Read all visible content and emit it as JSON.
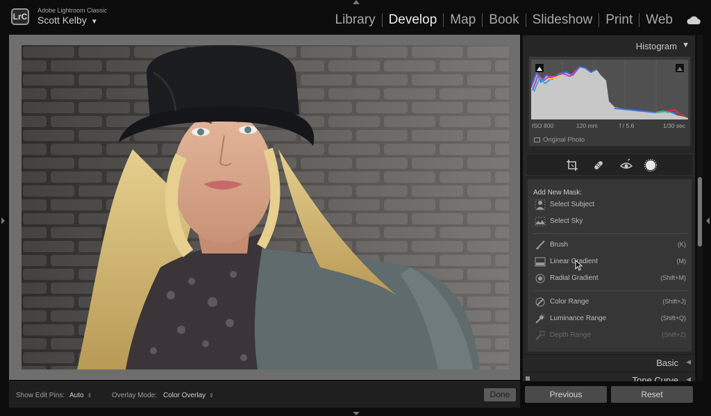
{
  "app": {
    "logo": "LrC",
    "name": "Adobe Lightroom Classic",
    "user": "Scott Kelby"
  },
  "modules": [
    "Library",
    "Develop",
    "Map",
    "Book",
    "Slideshow",
    "Print",
    "Web"
  ],
  "active_module": "Develop",
  "toolbar": {
    "show_edit_pins_label": "Show Edit Pins:",
    "show_edit_pins_value": "Auto",
    "overlay_mode_label": "Overlay Mode:",
    "overlay_mode_value": "Color Overlay",
    "done_label": "Done"
  },
  "histogram": {
    "title": "Histogram",
    "iso": "ISO 800",
    "focal_length": "120 mm",
    "aperture": "f / 5.6",
    "shutter": "1/30 sec",
    "original_photo": "Original Photo"
  },
  "tools": [
    "crop-icon",
    "healing-icon",
    "red-eye-icon",
    "masking-icon"
  ],
  "masking": {
    "heading": "Add New Mask:",
    "items": [
      {
        "label": "Select Subject",
        "shortcut": "",
        "icon": "person-icon"
      },
      {
        "label": "Select Sky",
        "shortcut": "",
        "icon": "sky-icon"
      },
      {
        "label": "Brush",
        "shortcut": "(K)",
        "icon": "brush-icon"
      },
      {
        "label": "Linear Gradient",
        "shortcut": "(M)",
        "icon": "linear-gradient-icon"
      },
      {
        "label": "Radial Gradient",
        "shortcut": "(Shift+M)",
        "icon": "radial-gradient-icon"
      },
      {
        "label": "Color Range",
        "shortcut": "(Shift+J)",
        "icon": "color-range-icon"
      },
      {
        "label": "Luminance Range",
        "shortcut": "(Shift+Q)",
        "icon": "luminance-range-icon"
      },
      {
        "label": "Depth Range",
        "shortcut": "(Shift+Z)",
        "icon": "depth-range-icon"
      }
    ]
  },
  "sections": {
    "basic": "Basic",
    "tone_curve": "Tone Curve"
  },
  "buttons": {
    "previous": "Previous",
    "reset": "Reset"
  },
  "colors": {
    "background": "#0c0c0c",
    "panel": "#262626",
    "mask_box": "#363636",
    "active_module": "#ededed",
    "inactive_module": "#a9a9a9"
  }
}
